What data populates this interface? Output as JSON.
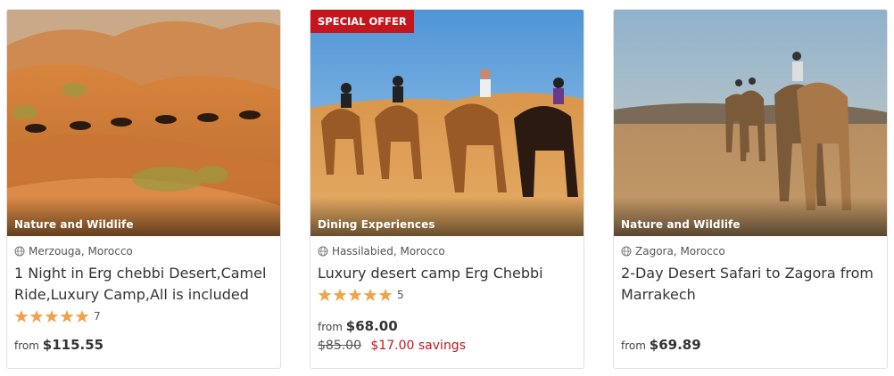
{
  "colors": {
    "accent_red": "#c4161c",
    "star": "#f0a44a"
  },
  "cards": [
    {
      "category": "Nature and Wildlife",
      "location": "Merzouga, Morocco",
      "title": "1 Night in Erg chebbi Desert,Camel Ride,Luxury Camp,All is included",
      "rating": {
        "stars": 5,
        "count": "7"
      },
      "price": {
        "from_label": "from",
        "amount": "$115.55"
      }
    },
    {
      "badge": "SPECIAL OFFER",
      "category": "Dining Experiences",
      "location": "Hassilabied, Morocco",
      "title": "Luxury desert camp Erg Chebbi",
      "rating": {
        "stars": 5,
        "count": "5"
      },
      "price": {
        "from_label": "from",
        "amount": "$68.00",
        "old_amount": "$85.00",
        "savings": "$17.00 savings"
      }
    },
    {
      "category": "Nature and Wildlife",
      "location": "Zagora, Morocco",
      "title": "2-Day Desert Safari to Zagora from Marrakech",
      "price": {
        "from_label": "from",
        "amount": "$69.89"
      }
    }
  ]
}
